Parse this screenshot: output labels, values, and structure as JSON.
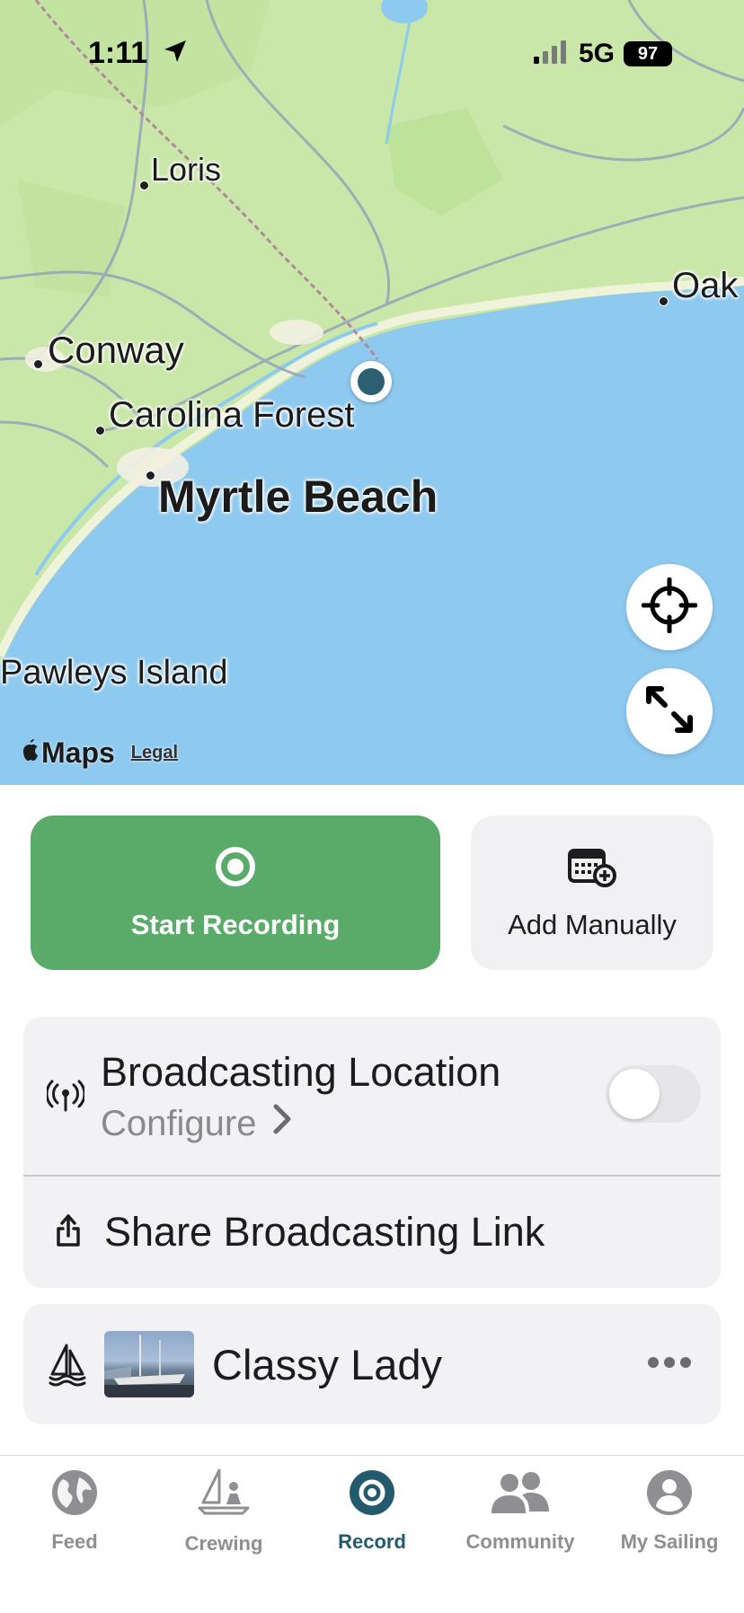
{
  "status_bar": {
    "time": "1:11",
    "network": "5G",
    "battery": "97"
  },
  "map": {
    "places": {
      "loris": "Loris",
      "conway": "Conway",
      "carolina_forest": "Carolina Forest",
      "myrtle_beach": "Myrtle Beach",
      "oak": "Oak",
      "pawleys_island": "Pawleys Island"
    },
    "attribution": "Maps",
    "legal": "Legal"
  },
  "actions": {
    "start_recording": "Start Recording",
    "add_manually": "Add Manually"
  },
  "broadcast": {
    "title": "Broadcasting Location",
    "configure": "Configure",
    "enabled": false,
    "share_link": "Share Broadcasting Link"
  },
  "boat": {
    "name": "Classy Lady"
  },
  "tabs": [
    {
      "label": "Feed",
      "icon": "globe-icon"
    },
    {
      "label": "Crewing",
      "icon": "sailor-icon"
    },
    {
      "label": "Record",
      "icon": "record-icon",
      "active": true
    },
    {
      "label": "Community",
      "icon": "people-icon"
    },
    {
      "label": "My Sailing",
      "icon": "person-icon"
    }
  ],
  "colors": {
    "accent": "#235a6e",
    "record_green": "#5aab6a",
    "water": "#8ec9ef",
    "land": "#c9e7a8"
  }
}
